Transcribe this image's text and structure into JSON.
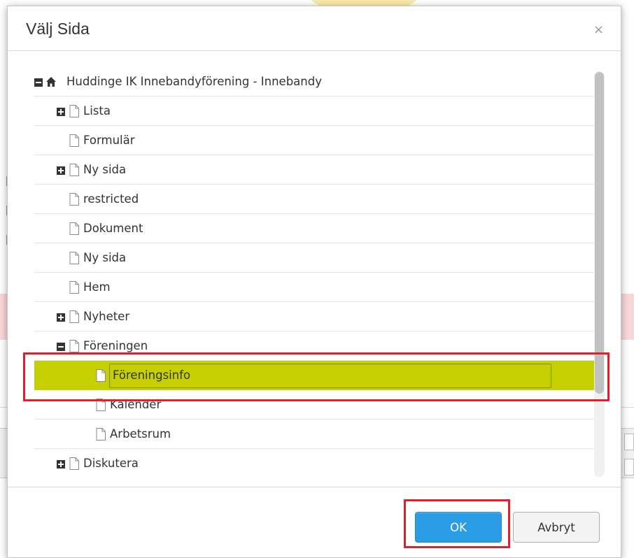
{
  "dialog": {
    "title": "Välj Sida",
    "close_glyph": "×"
  },
  "tree": {
    "nodes": [
      {
        "label": "Huddinge IK Innebandyförening - Innebandy",
        "icon": "home-icon",
        "toggle": "minus",
        "level": 0
      },
      {
        "label": "Lista",
        "icon": "page-icon",
        "toggle": "plus",
        "level": 1
      },
      {
        "label": "Formulär",
        "icon": "page-icon",
        "toggle": "none",
        "level": 1
      },
      {
        "label": "Ny sida",
        "icon": "page-icon",
        "toggle": "plus",
        "level": 1
      },
      {
        "label": "restricted",
        "icon": "page-icon",
        "toggle": "none",
        "level": 1
      },
      {
        "label": "Dokument",
        "icon": "page-icon",
        "toggle": "none",
        "level": 1
      },
      {
        "label": "Ny sida",
        "icon": "page-icon",
        "toggle": "none",
        "level": 1
      },
      {
        "label": "Hem",
        "icon": "page-icon",
        "toggle": "none",
        "level": 1
      },
      {
        "label": "Nyheter",
        "icon": "page-icon",
        "toggle": "plus",
        "level": 1
      },
      {
        "label": "Föreningen",
        "icon": "page-icon",
        "toggle": "minus",
        "level": 1
      },
      {
        "label": "Föreningsinfo",
        "icon": "page-icon",
        "toggle": "none",
        "level": 2,
        "selected": true
      },
      {
        "label": "Kalender",
        "icon": "page-icon",
        "toggle": "none",
        "level": 2
      },
      {
        "label": "Arbetsrum",
        "icon": "page-icon",
        "toggle": "none",
        "level": 2
      },
      {
        "label": "Diskutera",
        "icon": "page-icon",
        "toggle": "plus",
        "level": 1
      }
    ]
  },
  "footer": {
    "ok_label": "OK",
    "cancel_label": "Avbryt"
  },
  "colors": {
    "selected_row": "#c6cf00",
    "ok_button": "#2a9de6",
    "highlight_frame": "#e0212b"
  }
}
